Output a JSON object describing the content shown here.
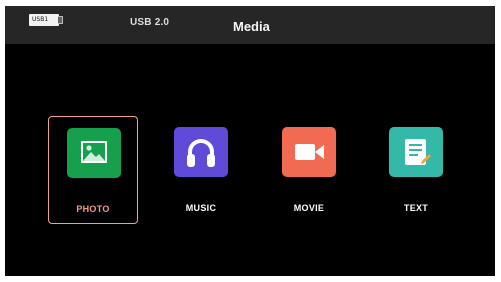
{
  "header": {
    "usb_badge": "USB1",
    "usb_version": "USB 2.0",
    "title": "Media"
  },
  "media_items": [
    {
      "label": "PHOTO",
      "icon": "photo-icon",
      "color": "#16a04e",
      "selected": true
    },
    {
      "label": "MUSIC",
      "icon": "headphones-icon",
      "color": "#5f4bd8",
      "selected": false
    },
    {
      "label": "MOVIE",
      "icon": "video-camera-icon",
      "color": "#f06b52",
      "selected": false
    },
    {
      "label": "TEXT",
      "icon": "document-icon",
      "color": "#34b8a8",
      "selected": false
    }
  ],
  "colors": {
    "background": "#000000",
    "topbar": "#262626",
    "selection": "#f29f94"
  }
}
